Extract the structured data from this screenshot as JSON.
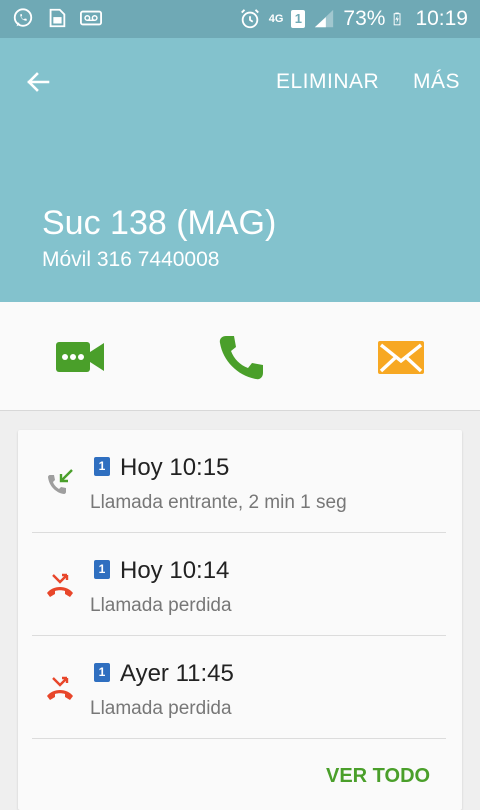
{
  "status_bar": {
    "network": "4G",
    "sim": "1",
    "battery": "73%",
    "time": "10:19",
    "icons": [
      "whatsapp-icon",
      "sim-card-icon",
      "voicemail-icon",
      "alarm-icon",
      "signal-icon",
      "battery-charging-icon"
    ]
  },
  "header": {
    "back_icon": "arrow-back-icon",
    "delete_label": "ELIMINAR",
    "more_label": "MÁS",
    "contact_name": "Suc 138 (MAG)",
    "contact_number": "Móvil 316 7440008",
    "background_color": "#83c2cd"
  },
  "actions": {
    "video_call_icon": "video-message-icon",
    "call_icon": "phone-icon",
    "message_icon": "envelope-icon"
  },
  "call_log": {
    "entries": [
      {
        "sim": "1",
        "time": "Hoy 10:15",
        "description": "Llamada entrante, 2 min 1 seg",
        "type": "incoming"
      },
      {
        "sim": "1",
        "time": "Hoy 10:14",
        "description": "Llamada perdida",
        "type": "missed"
      },
      {
        "sim": "1",
        "time": "Ayer 11:45",
        "description": "Llamada perdida",
        "type": "missed"
      }
    ],
    "view_all_label": "VER TODO"
  },
  "colors": {
    "status_bar": "#6fa9b5",
    "accent_green": "#4a9f2a",
    "missed_red": "#e8462a",
    "message_orange": "#f7a823",
    "sim_blue": "#2f6fc0"
  }
}
